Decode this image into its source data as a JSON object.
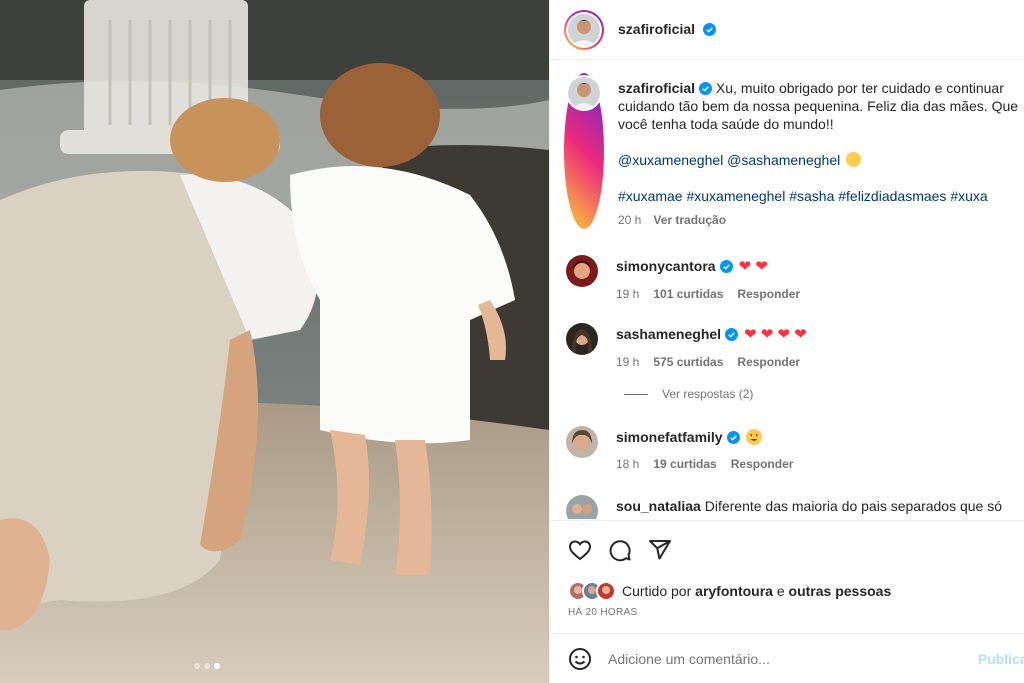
{
  "post": {
    "author": "szafiroficial",
    "caption_text": "Xu, muito obrigado por ter cuidado e continuar cuidando tão bem da nossa pequenina. Feliz dia das mães. Que você tenha toda saúde do mundo!!",
    "mentions": "@xuxameneghel @sashameneghel",
    "hashtags": "#xuxamae #xuxameneghel #sasha #felizdiadasmaes #xuxa",
    "time": "20 h",
    "see_translation": "Ver tradução"
  },
  "comments": [
    {
      "user": "simonycantora",
      "text": "",
      "hearts": "❤ ❤",
      "time": "19 h",
      "likes": "101 curtidas",
      "reply": "Responder"
    },
    {
      "user": "sashameneghel",
      "text": "",
      "hearts": "❤ ❤ ❤ ❤",
      "time": "19 h",
      "likes": "575 curtidas",
      "reply": "Responder"
    },
    {
      "user": "simonefatfamily",
      "text": "",
      "hearts": "",
      "time": "18 h",
      "likes": "19 curtidas",
      "reply": "Responder"
    },
    {
      "user": "sou_nataliaa",
      "text": "Diferente das maioria do pais separados que só"
    }
  ],
  "view_replies": "Ver respostas (2)",
  "likes": {
    "prefix": "Curtido por",
    "user": "aryfontoura",
    "connector": "e",
    "others": "outras pessoas"
  },
  "time_ago": "HÁ 20 HORAS",
  "comment_box": {
    "placeholder": "Adicione um comentário...",
    "publish_label": "Publicar"
  },
  "icons": [
    "verified-badge-icon",
    "heart-icon",
    "comment-icon",
    "share-icon",
    "emoji-icon"
  ],
  "colors": {
    "link": "#00376b",
    "verified": "#0095f6",
    "heart": "#ff3040",
    "publish": "#b2dffc",
    "muted": "#737373"
  }
}
